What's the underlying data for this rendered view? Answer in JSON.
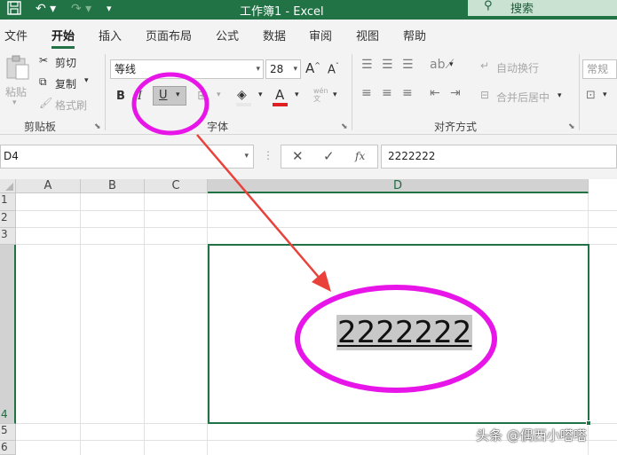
{
  "app": {
    "title": "工作簿1  -  Excel",
    "search_label": "搜索"
  },
  "tabs": [
    "文件",
    "开始",
    "插入",
    "页面布局",
    "公式",
    "数据",
    "审阅",
    "视图",
    "帮助"
  ],
  "active_tab": "开始",
  "clipboard": {
    "paste": "粘贴",
    "cut": "剪切",
    "copy": "复制",
    "format_painter": "格式刷",
    "group": "剪贴板"
  },
  "font": {
    "name": "等线",
    "size": "28",
    "bold": "B",
    "italic": "I",
    "underline": "U",
    "color_letter": "A",
    "group": "字体"
  },
  "alignment": {
    "wrap": "自动换行",
    "merge": "合并后居中",
    "group": "对齐方式"
  },
  "number": {
    "format": "常规"
  },
  "name_box": "D4",
  "formula_bar": {
    "fx": "fx",
    "content": "2222222"
  },
  "grid": {
    "columns": [
      "A",
      "B",
      "C",
      "D"
    ],
    "rows": [
      "1",
      "2",
      "3",
      "4",
      "5",
      "6"
    ],
    "selected_cell": "D4",
    "cell_value": "2222222"
  },
  "colors": {
    "excel_green": "#217346",
    "annotation": "#e815e8",
    "arrow": "#e8423a"
  },
  "watermark": "头条 @偶西小嗒嗒"
}
